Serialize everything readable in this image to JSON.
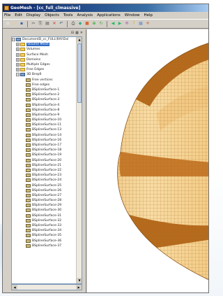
{
  "window": {
    "title": "GeoMesh - [cc_full_clmassive]"
  },
  "menu": [
    "File",
    "Edit",
    "Display",
    "Objects",
    "Tools",
    "Analysis",
    "Applications",
    "Window",
    "Help"
  ],
  "toolbar_icons": [
    "new-icon",
    "open-icon",
    "save-icon",
    "cut-icon",
    "copy-icon",
    "paste-icon",
    "delete-icon",
    "undo-icon",
    "print-icon",
    "mesh-icon",
    "render-icon",
    "zoom-icon",
    "rotate-icon",
    "prev-icon",
    "next-icon",
    "pan-icon",
    "help-icon",
    "grid-icon",
    "axis-icon"
  ],
  "tree": {
    "root": "DocumentD_cc_FULL\\RAY.Dxl",
    "folders": [
      {
        "label": "Volume Mesh",
        "selected": true
      },
      {
        "label": "Volumes",
        "selected": false
      },
      {
        "label": "Surface Mesh",
        "selected": false
      },
      {
        "label": "Domains",
        "selected": false
      },
      {
        "label": "Multiple Edges",
        "selected": false
      },
      {
        "label": "Free Edges",
        "selected": false
      }
    ],
    "brep": "3D Brep6",
    "brep_children": [
      "Free vertices",
      "Free edges"
    ],
    "surfaces": [
      "BSplineSurface-1",
      "BSplineSurface-2",
      "BSplineSurface-3",
      "BSplineSurface-4",
      "BSplineSurface-8",
      "BSplineSurface-9",
      "BSplineSurface-10",
      "BSplineSurface-11",
      "BSplineSurface-13",
      "BSplineSurface-14",
      "BSplineSurface-16",
      "BSplineSurface-17",
      "BSplineSurface-18",
      "BSplineSurface-19",
      "BSplineSurface-20",
      "BSplineSurface-21",
      "BSplineSurface-22",
      "BSplineSurface-23",
      "BSplineSurface-24",
      "BSplineSurface-25",
      "BSplineSurface-26",
      "BSplineSurface-27",
      "BSplineSurface-28",
      "BSplineSurface-29",
      "BSplineSurface-30",
      "BSplineSurface-31",
      "BSplineSurface-32",
      "BSplineSurface-33",
      "BSplineSurface-34",
      "BSplineSurface-35",
      "BSplineSurface-36",
      "BSplineSurface-37"
    ]
  },
  "colors": {
    "mesh_light": "#f6d79b",
    "mesh_mid": "#e9b35f",
    "mesh_band": "#b66a1c",
    "selection": "#316ac5"
  }
}
